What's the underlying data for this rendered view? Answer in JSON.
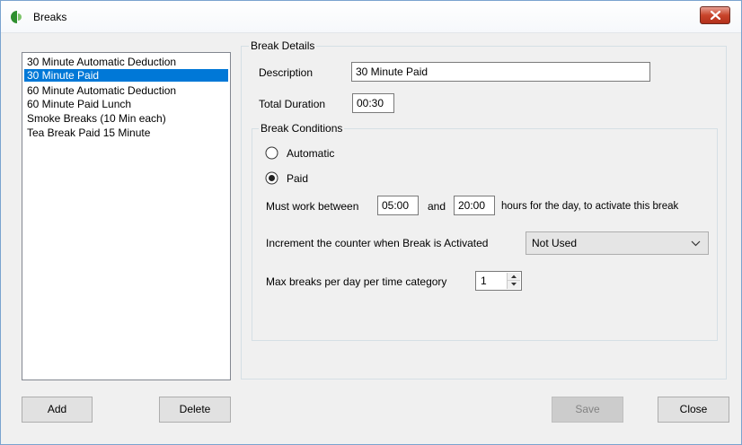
{
  "window": {
    "title": "Breaks"
  },
  "breaks_list": {
    "items": [
      {
        "label": "30 Minute Automatic Deduction"
      },
      {
        "label": "30 Minute Paid"
      },
      {
        "label": "60 Minute Automatic Deduction"
      },
      {
        "label": "60 Minute Paid Lunch"
      },
      {
        "label": "Smoke Breaks (10 Min each)"
      },
      {
        "label": "Tea Break Paid 15 Minute"
      }
    ],
    "selected": "30 Minute Paid"
  },
  "details": {
    "group_label": "Break Details",
    "description_label": "Description",
    "description_value": "30 Minute Paid",
    "total_duration_label": "Total Duration",
    "total_duration_value": "00:30"
  },
  "conditions": {
    "group_label": "Break Conditions",
    "automatic_label": "Automatic",
    "paid_label": "Paid",
    "selected_option": "Paid",
    "must_work_label": "Must work between",
    "start_time": "05:00",
    "and_label": "and",
    "end_time": "20:00",
    "hours_suffix": "hours for the day, to activate this break",
    "increment_label": "Increment the counter when Break is Activated",
    "increment_value": "Not Used",
    "max_breaks_label": "Max breaks per day per time category",
    "max_breaks_value": "1"
  },
  "buttons": {
    "add": "Add",
    "delete": "Delete",
    "save": "Save",
    "close": "Close"
  },
  "colors": {
    "selection": "#0078d7",
    "close_button": "#c8442b",
    "app_icon": "#3a9b3a"
  }
}
